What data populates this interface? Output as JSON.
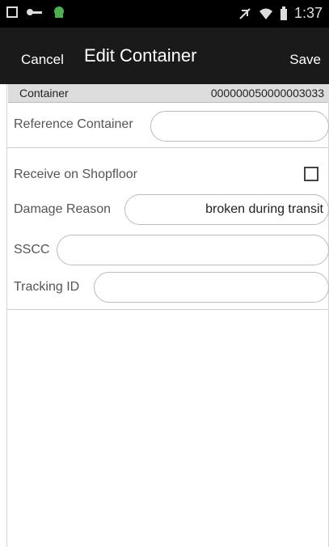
{
  "status": {
    "time": "1:37"
  },
  "appbar": {
    "cancel": "Cancel",
    "title": "Edit Container",
    "save": "Save"
  },
  "container": {
    "label": "Container",
    "value": "000000050000003033"
  },
  "form": {
    "reference_container": {
      "label": "Reference Container",
      "value": ""
    },
    "receive_on_shopfloor": {
      "label": "Receive on Shopfloor",
      "checked": false
    },
    "damage_reason": {
      "label": "Damage Reason",
      "value": "broken during transit"
    },
    "sscc": {
      "label": "SSCC",
      "value": ""
    },
    "tracking_id": {
      "label": "Tracking ID",
      "value": ""
    }
  },
  "icons": {
    "status_left": [
      "image-icon",
      "key-icon",
      "android-icon"
    ],
    "status_right": [
      "mute-icon",
      "wifi-icon",
      "battery-icon"
    ]
  }
}
